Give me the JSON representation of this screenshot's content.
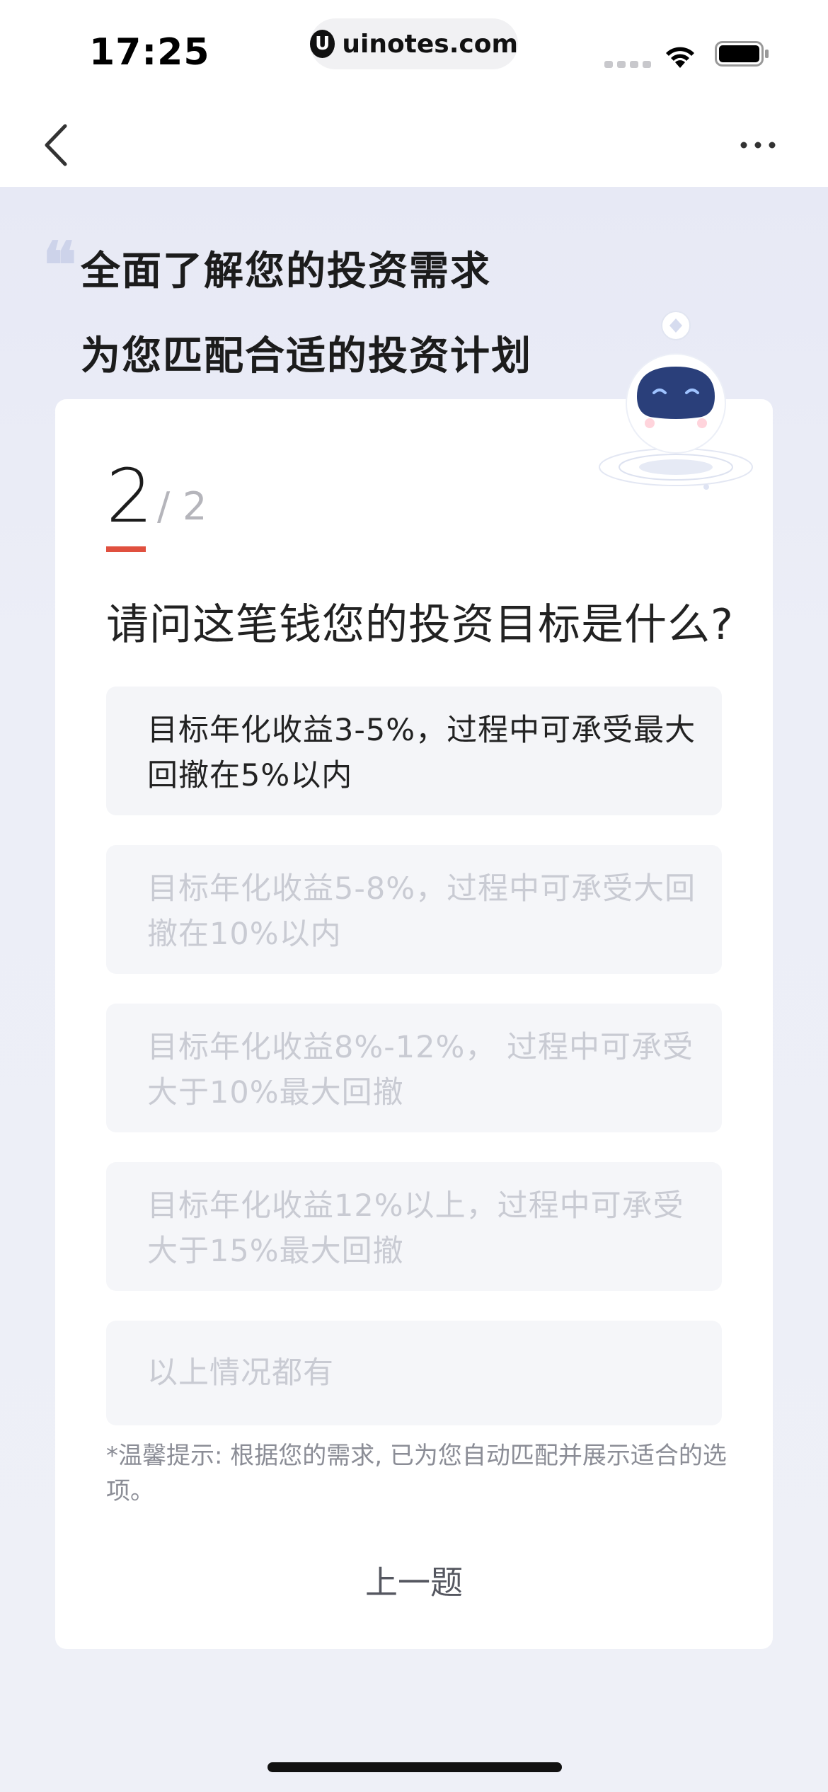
{
  "status_bar": {
    "time": "17:25",
    "url": "uinotes.com",
    "url_logo": "U"
  },
  "nav": {
    "back_icon": "chevron-left-icon",
    "more_icon": "more-horizontal-icon"
  },
  "hero": {
    "title_line1": "全面了解您的投资需求",
    "title_line2": "为您匹配合适的投资计划",
    "quote_mark": "❝"
  },
  "step": {
    "current": "2",
    "separator": "/",
    "total": "2"
  },
  "question": "请问这笔钱您的投资目标是什么?",
  "options": [
    {
      "label": "目标年化收益3-5%，过程中可承受最大回撤在5%以内",
      "selected": true
    },
    {
      "label": "目标年化收益5-8%，过程中可承受大回撤在10%以内",
      "selected": false
    },
    {
      "label": "目标年化收益8%-12%， 过程中可承受大于10%最大回撤",
      "selected": false
    },
    {
      "label": "目标年化收益12%以上，过程中可承受大于15%最大回撤",
      "selected": false
    },
    {
      "label": "以上情况都有",
      "selected": false
    }
  ],
  "tip": "*温馨提示: 根据您的需求, 已为您自动匹配并展示适合的选项。",
  "prev_button": "上一题",
  "colors": {
    "accent": "#e0503f",
    "text_primary": "#222222",
    "text_disabled": "#c9cbd3",
    "option_bg": "#f5f6f9",
    "robot_face": "#2a3f7a"
  }
}
